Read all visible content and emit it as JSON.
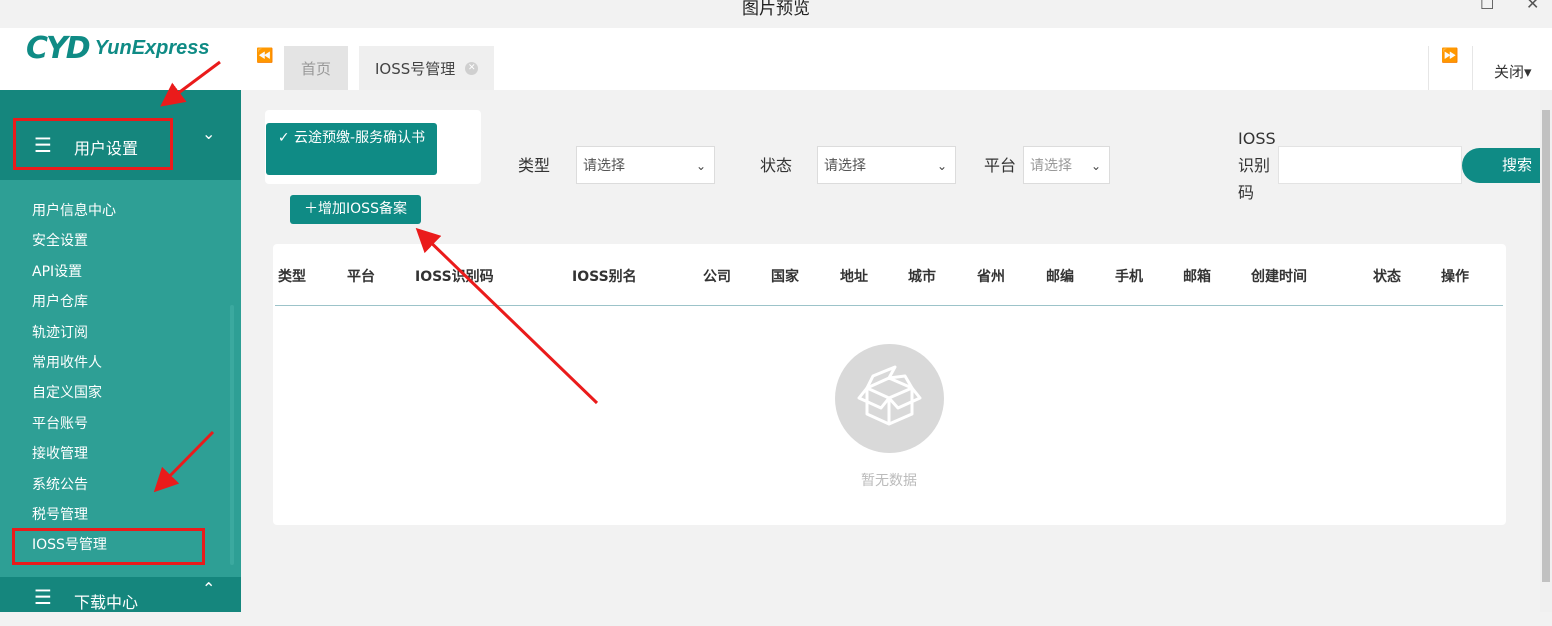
{
  "window": {
    "title": "图片预览",
    "minimize_glyph": "☐",
    "close_glyph": "✕"
  },
  "header": {
    "logo_mark": "CYD",
    "logo_text": "YunExpress",
    "prev_glyph": "⏪",
    "next_glyph": "⏩",
    "tabs": [
      {
        "label": "首页"
      },
      {
        "label": "IOSS号管理",
        "close_glyph": "✕"
      }
    ],
    "close_menu_label": "关闭▾"
  },
  "sidebar": {
    "group_user": {
      "icon": "list-icon",
      "label": "用户设置",
      "chevron": "⌄"
    },
    "items": [
      {
        "label": "用户信息中心"
      },
      {
        "label": "安全设置"
      },
      {
        "label": "API设置"
      },
      {
        "label": "用户仓库"
      },
      {
        "label": "轨迹订阅"
      },
      {
        "label": "常用收件人"
      },
      {
        "label": "自定义国家"
      },
      {
        "label": "平台账号"
      },
      {
        "label": "接收管理"
      },
      {
        "label": "系统公告"
      },
      {
        "label": "税号管理"
      },
      {
        "label": "IOSS号管理"
      }
    ],
    "group_download": {
      "icon": "list-icon",
      "label": "下载中心",
      "chevron": "⌃"
    }
  },
  "toolbar": {
    "confirm_label": "✓ 云途预缴-服务确认书",
    "add_label": "＋增加IOSS备案"
  },
  "filters": {
    "type_label": "类型",
    "type_value": "请选择",
    "status_label": "状态",
    "status_value": "请选择",
    "platform_label": "平台",
    "platform_value": "请选择",
    "ioss_label": "IOSS识别码",
    "ioss_value": "",
    "search_label": "搜索"
  },
  "table": {
    "columns": [
      "类型",
      "平台",
      "IOSS识别码",
      "IOSS别名",
      "公司",
      "国家",
      "地址",
      "城市",
      "省州",
      "邮编",
      "手机",
      "邮箱",
      "创建时间",
      "状态",
      "操作"
    ],
    "empty_text": "暂无数据"
  },
  "colors": {
    "brand": "#0f8b85",
    "sidebar_bg": "#2e9f95",
    "sidebar_group_bg": "#15867d",
    "annotation_red": "#ea1b1b"
  }
}
